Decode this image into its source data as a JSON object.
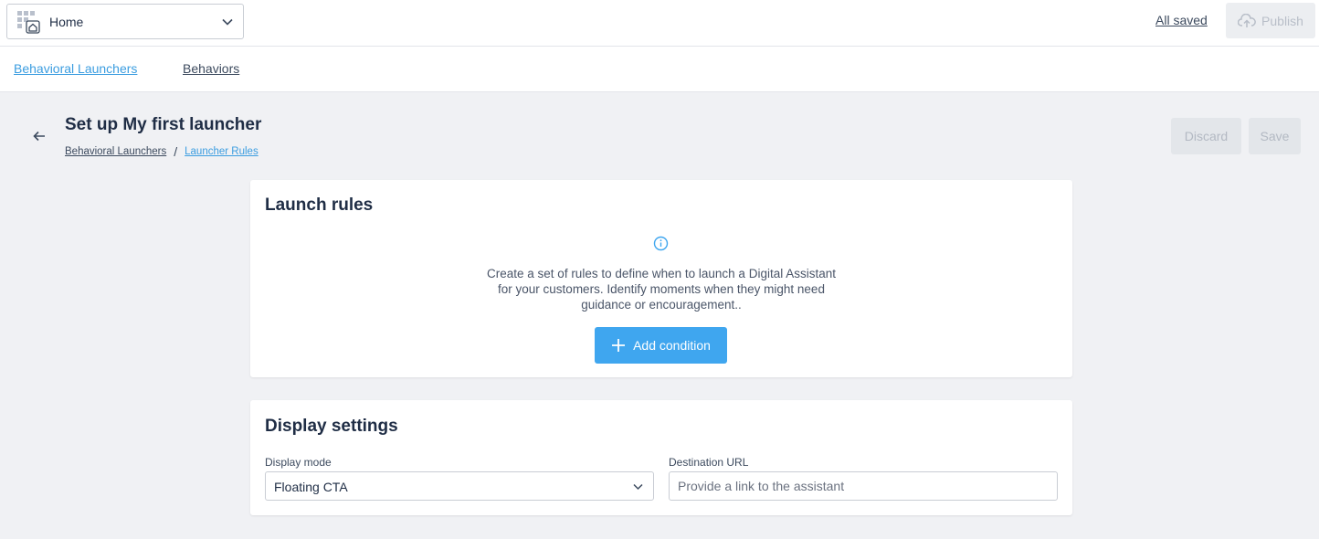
{
  "topbar": {
    "workspace_label": "Home",
    "status_text": "All saved",
    "publish_label": "Publish"
  },
  "subnav": {
    "items": [
      {
        "label": "Behavioral Launchers",
        "active": true
      },
      {
        "label": "Behaviors",
        "active": false
      }
    ]
  },
  "header": {
    "title": "Set up My first launcher",
    "breadcrumb": [
      "Behavioral Launchers",
      "Launcher Rules"
    ],
    "breadcrumb_separator": "/",
    "discard_label": "Discard",
    "save_label": "Save"
  },
  "launch_rules": {
    "title": "Launch rules",
    "description": "Create a set of rules to define when to launch a Digital Assistant for your customers. Identify moments when they might need guidance or encouragement..",
    "add_condition_label": "Add condition"
  },
  "display_settings": {
    "title": "Display settings",
    "display_mode_label": "Display mode",
    "display_mode_value": "Floating CTA",
    "destination_url_label": "Destination URL",
    "destination_url_placeholder": "Provide a link to the assistant",
    "destination_url_value": ""
  },
  "colors": {
    "accent": "#3fa6ef",
    "link_active": "#3b9de0",
    "text_dark": "#1f2d45",
    "page_bg": "#f0f1f4"
  },
  "icons": {
    "workspace": "home-grid-icon",
    "chevron": "chevron-down-icon",
    "publish": "cloud-upload-icon",
    "back": "arrow-left-icon",
    "info": "info-icon",
    "add": "plus-icon"
  }
}
